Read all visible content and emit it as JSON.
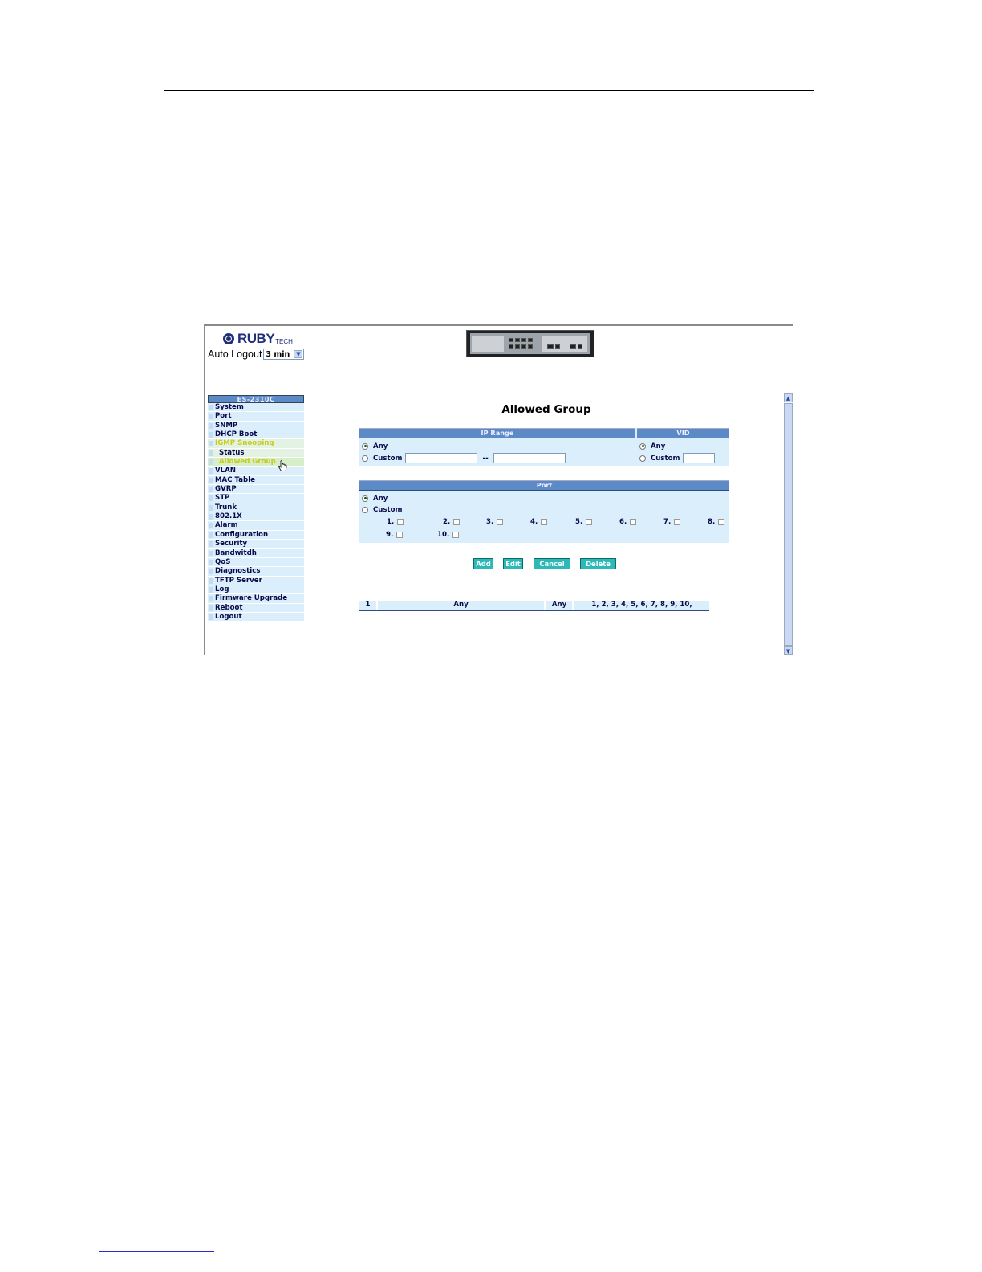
{
  "brand": {
    "name": "RUBY",
    "suffix": "TECH"
  },
  "auto_logout": {
    "label": "Auto Logout",
    "value": "3 min",
    "arrow": "chevron-down-icon"
  },
  "sidebar": {
    "header": "ES-2310C",
    "items": [
      {
        "label": "System"
      },
      {
        "label": "Port"
      },
      {
        "label": "SNMP"
      },
      {
        "label": "DHCP Boot"
      },
      {
        "label": "IGMP Snooping",
        "state": "active"
      },
      {
        "label": "Status",
        "sub": true
      },
      {
        "label": "Allowed Group",
        "sub": true,
        "state": "current"
      },
      {
        "label": "VLAN"
      },
      {
        "label": "MAC Table"
      },
      {
        "label": "GVRP"
      },
      {
        "label": "STP"
      },
      {
        "label": "Trunk"
      },
      {
        "label": "802.1X"
      },
      {
        "label": "Alarm"
      },
      {
        "label": "Configuration"
      },
      {
        "label": "Security"
      },
      {
        "label": "Bandwitdh"
      },
      {
        "label": "QoS"
      },
      {
        "label": "Diagnostics"
      },
      {
        "label": "TFTP Server"
      },
      {
        "label": "Log"
      },
      {
        "label": "Firmware Upgrade"
      },
      {
        "label": "Reboot"
      },
      {
        "label": "Logout"
      }
    ]
  },
  "page_title": "Allowed Group",
  "ip_range": {
    "header": "IP Range",
    "any_label": "Any",
    "custom_label": "Custom",
    "separator": "--",
    "selected": "Any",
    "start_value": "",
    "end_value": ""
  },
  "vid": {
    "header": "VID",
    "any_label": "Any",
    "custom_label": "Custom",
    "selected": "Any",
    "value": ""
  },
  "port": {
    "header": "Port",
    "any_label": "Any",
    "custom_label": "Custom",
    "selected": "Any",
    "ports": [
      "1.",
      "2.",
      "3.",
      "4.",
      "5.",
      "6.",
      "7.",
      "8.",
      "9.",
      "10."
    ]
  },
  "buttons": {
    "add": "Add",
    "edit": "Edit",
    "cancel": "Cancel",
    "delete": "Delete"
  },
  "results": {
    "rows": [
      {
        "index": "1",
        "ip_range": "Any",
        "vid": "Any",
        "ports": "1, 2, 3, 4, 5, 6, 7, 8, 9, 10,"
      }
    ]
  },
  "colors": {
    "header_blue": "#5b8ac6",
    "panel_light": "#dbeefb",
    "button_teal": "#2fb8b8",
    "active_menu": "#c7cc1a"
  }
}
